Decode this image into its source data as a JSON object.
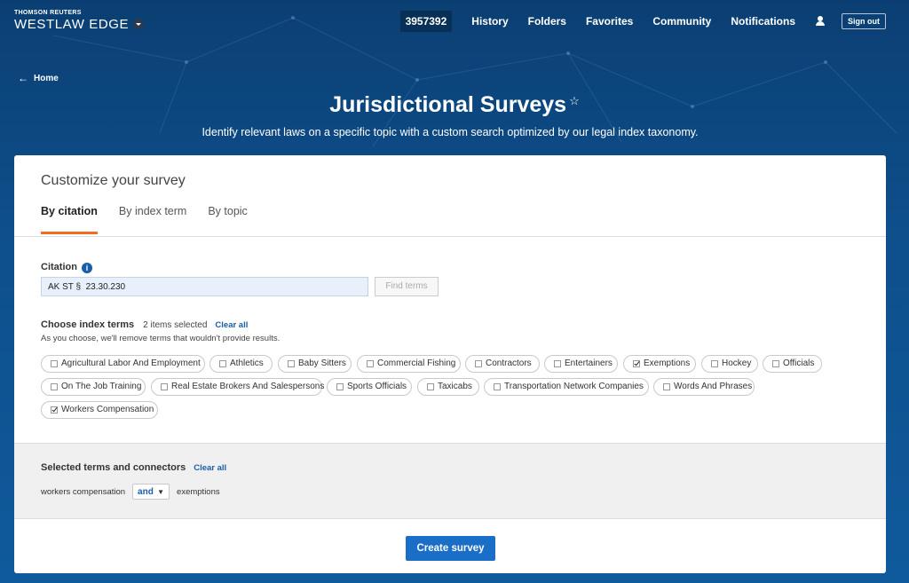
{
  "header": {
    "brand_small": "THOMSON REUTERS",
    "brand_big": "WESTLAW EDGE",
    "nav": {
      "client_id": "3957392",
      "history": "History",
      "folders": "Folders",
      "favorites": "Favorites",
      "community": "Community",
      "notifications": "Notifications",
      "sign_out": "Sign out"
    }
  },
  "breadcrumb": {
    "home": "Home"
  },
  "hero": {
    "title": "Jurisdictional Surveys",
    "subtitle": "Identify relevant laws on a specific topic with a custom search optimized by our legal index taxonomy."
  },
  "card": {
    "title": "Customize your survey",
    "tabs": [
      {
        "label": "By citation",
        "active": true
      },
      {
        "label": "By index term",
        "active": false
      },
      {
        "label": "By topic",
        "active": false
      }
    ],
    "citation": {
      "label": "Citation",
      "value": "AK ST §  23.30.230",
      "find_button": "Find terms"
    },
    "index_terms": {
      "label": "Choose index terms",
      "count_text": "2 items selected",
      "clear_all": "Clear all",
      "hint": "As you choose, we'll remove terms that wouldn't provide results.",
      "terms": [
        {
          "label": "Agricultural Labor And Employment",
          "checked": false
        },
        {
          "label": "Athletics",
          "checked": false
        },
        {
          "label": "Baby Sitters",
          "checked": false
        },
        {
          "label": "Commercial Fishing",
          "checked": false
        },
        {
          "label": "Contractors",
          "checked": false
        },
        {
          "label": "Entertainers",
          "checked": false
        },
        {
          "label": "Exemptions",
          "checked": true
        },
        {
          "label": "Hockey",
          "checked": false
        },
        {
          "label": "Officials",
          "checked": false
        },
        {
          "label": "On The Job Training",
          "checked": false
        },
        {
          "label": "Real Estate Brokers And Salespersons",
          "checked": false
        },
        {
          "label": "Sports Officials",
          "checked": false
        },
        {
          "label": "Taxicabs",
          "checked": false
        },
        {
          "label": "Transportation Network Companies",
          "checked": false
        },
        {
          "label": "Words And Phrases",
          "checked": false
        },
        {
          "label": "Workers Compensation",
          "checked": true
        }
      ]
    },
    "selected": {
      "title": "Selected terms and connectors",
      "clear_all": "Clear all",
      "term_left": "workers compensation",
      "connector": "and",
      "term_right": "exemptions"
    },
    "create_button": "Create survey"
  }
}
